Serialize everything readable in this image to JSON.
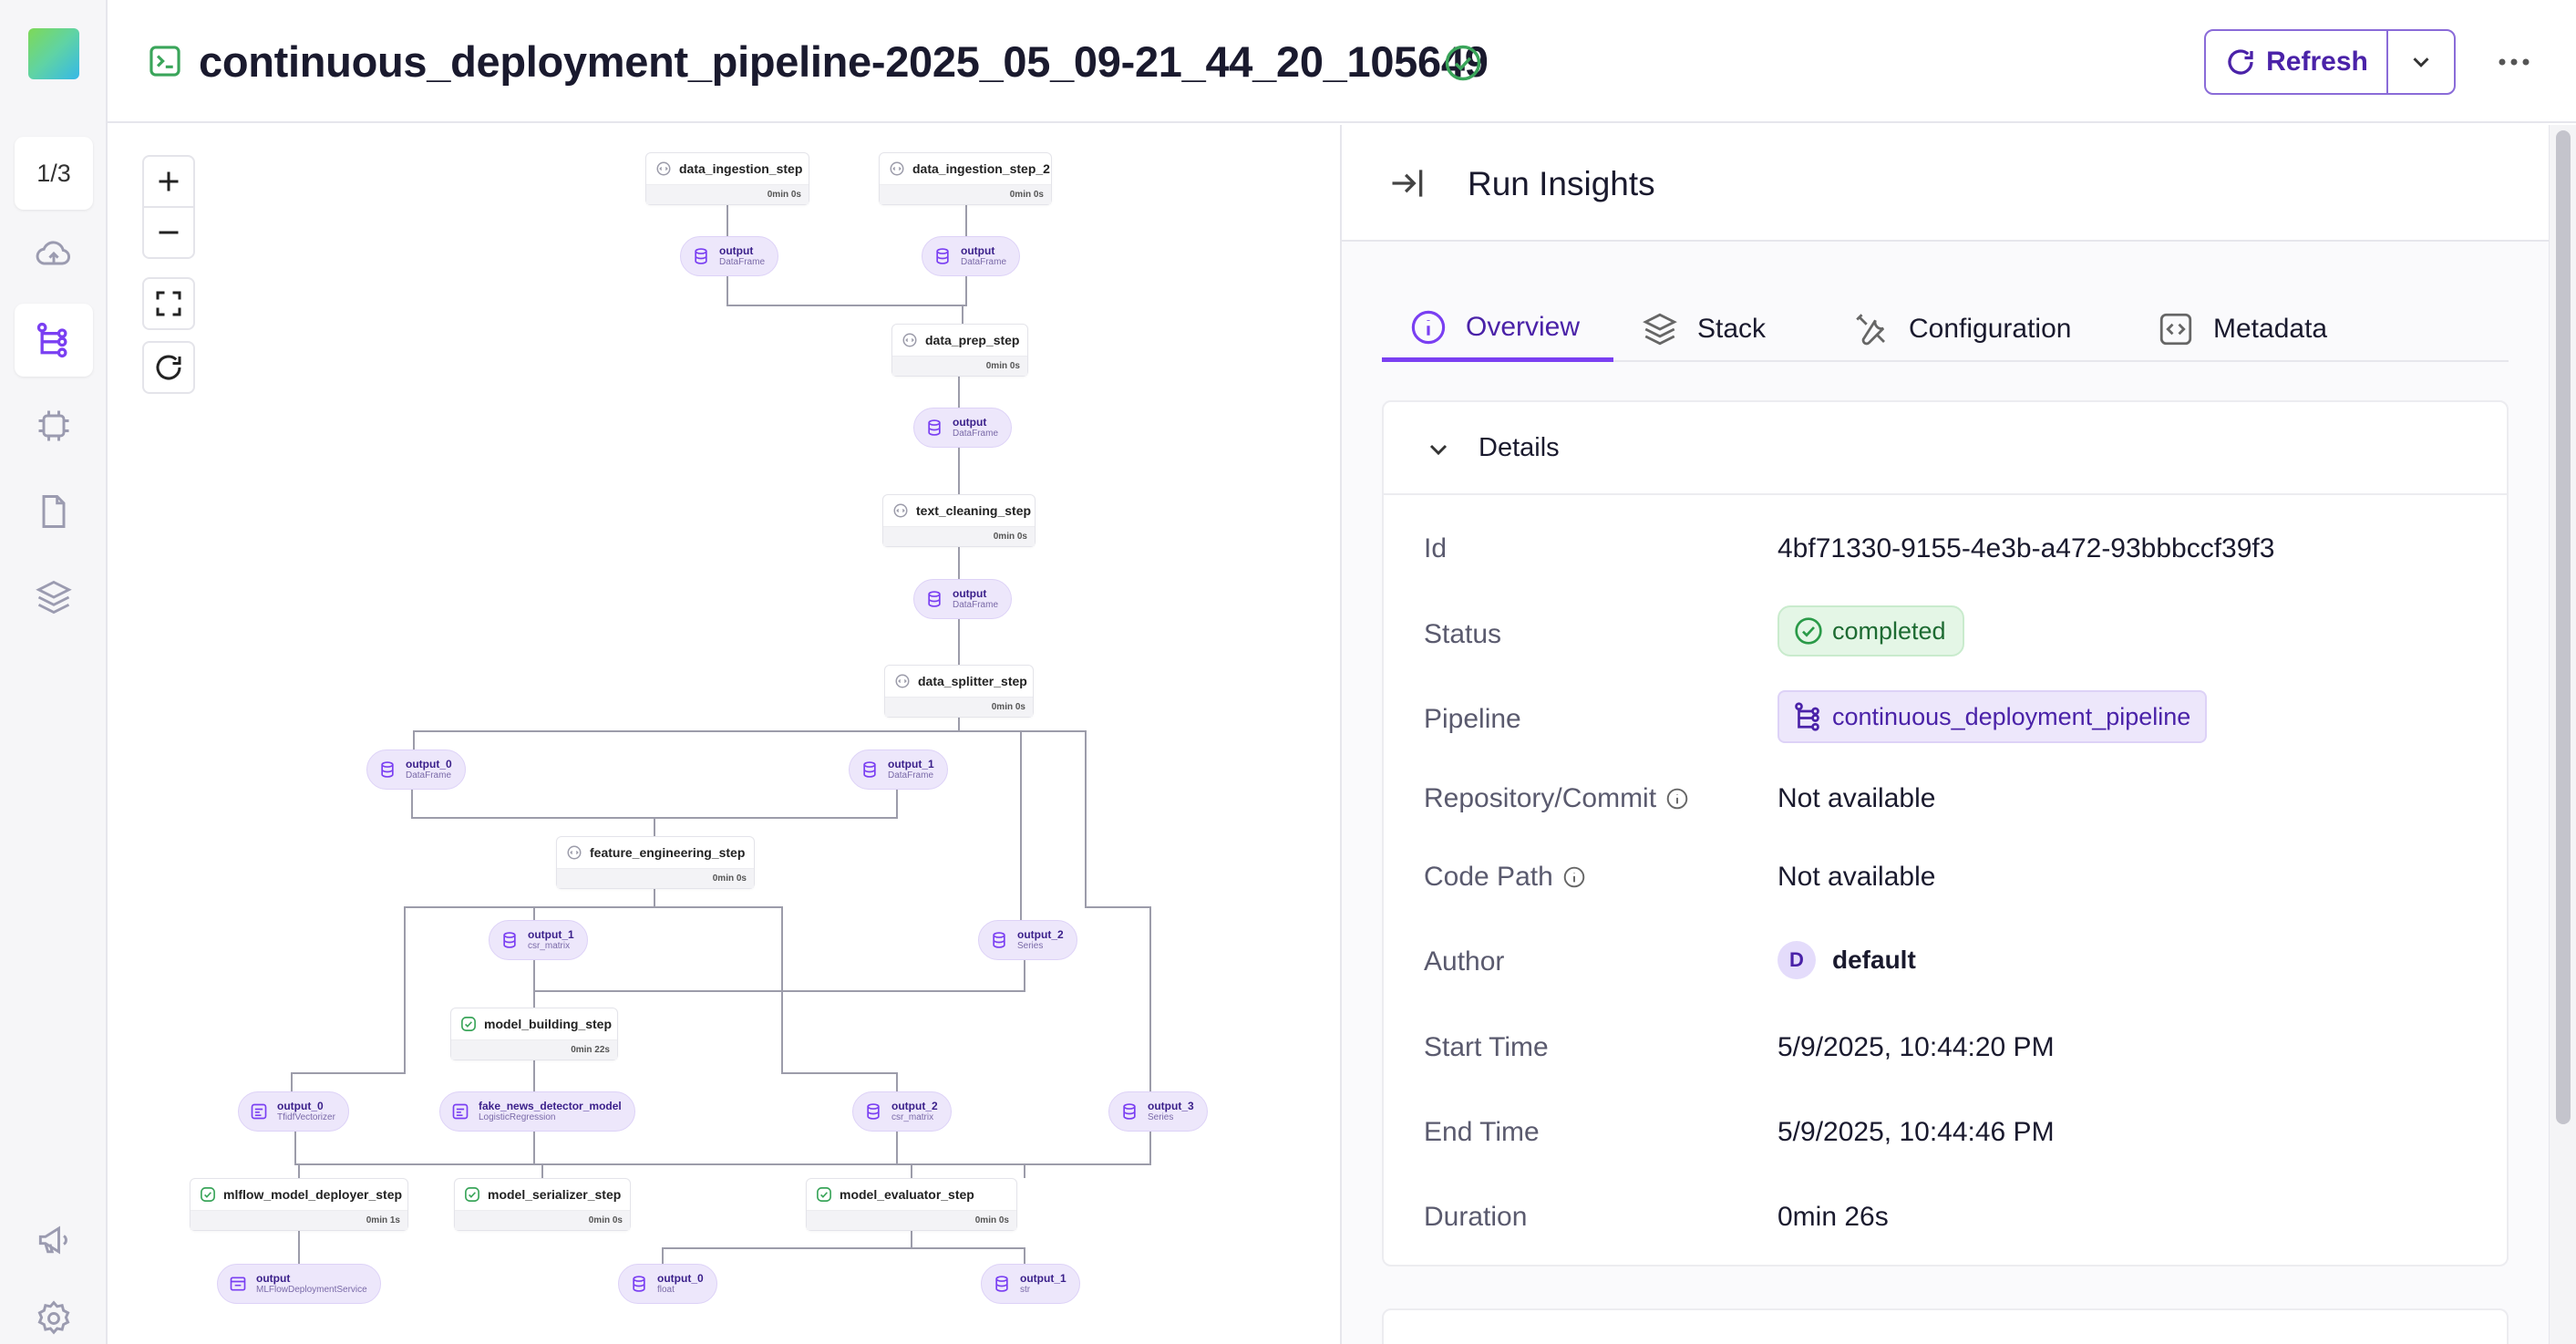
{
  "sidebar": {
    "counter": "1/3",
    "items": [
      {
        "icon": "cloud-icon"
      },
      {
        "icon": "pipeline-icon",
        "active": true
      },
      {
        "icon": "chip-icon"
      },
      {
        "icon": "document-icon"
      },
      {
        "icon": "stack-icon"
      },
      {
        "icon": "megaphone-icon"
      },
      {
        "icon": "gear-icon"
      }
    ]
  },
  "header": {
    "title": "continuous_deployment_pipeline-2025_05_09-21_44_20_105649",
    "refresh_label": "Refresh"
  },
  "dag": {
    "steps": [
      {
        "name": "data_ingestion_step",
        "duration": "0min 0s",
        "status": "cached"
      },
      {
        "name": "data_ingestion_step_2",
        "duration": "0min 0s",
        "status": "cached"
      },
      {
        "name": "data_prep_step",
        "duration": "0min 0s",
        "status": "cached"
      },
      {
        "name": "text_cleaning_step",
        "duration": "0min 0s",
        "status": "cached"
      },
      {
        "name": "data_splitter_step",
        "duration": "0min 0s",
        "status": "cached"
      },
      {
        "name": "feature_engineering_step",
        "duration": "0min 0s",
        "status": "cached"
      },
      {
        "name": "model_building_step",
        "duration": "0min 22s",
        "status": "completed"
      },
      {
        "name": "mlflow_model_deployer_step",
        "duration": "0min 1s",
        "status": "completed"
      },
      {
        "name": "model_serializer_step",
        "duration": "0min 0s",
        "status": "completed"
      },
      {
        "name": "model_evaluator_step",
        "duration": "0min 0s",
        "status": "completed"
      }
    ],
    "artifacts": [
      {
        "name": "output",
        "type": "DataFrame"
      },
      {
        "name": "output",
        "type": "DataFrame"
      },
      {
        "name": "output",
        "type": "DataFrame"
      },
      {
        "name": "output",
        "type": "DataFrame"
      },
      {
        "name": "output_0",
        "type": "DataFrame"
      },
      {
        "name": "output_1",
        "type": "DataFrame"
      },
      {
        "name": "output_1",
        "type": "csr_matrix"
      },
      {
        "name": "output_2",
        "type": "Series"
      },
      {
        "name": "output_0",
        "type": "TfidfVectorizer"
      },
      {
        "name": "fake_news_detector_model",
        "type": "LogisticRegression"
      },
      {
        "name": "output_2",
        "type": "csr_matrix"
      },
      {
        "name": "output_3",
        "type": "Series"
      },
      {
        "name": "output",
        "type": "MLFlowDeploymentService"
      },
      {
        "name": "output_0",
        "type": "float"
      },
      {
        "name": "output_1",
        "type": "str"
      }
    ]
  },
  "insights": {
    "title": "Run Insights",
    "tabs": [
      "Overview",
      "Stack",
      "Configuration",
      "Metadata"
    ],
    "details_title": "Details",
    "rows": {
      "id_label": "Id",
      "id_value": "4bf71330-9155-4e3b-a472-93bbbccf39f3",
      "status_label": "Status",
      "status_value": "completed",
      "pipeline_label": "Pipeline",
      "pipeline_value": "continuous_deployment_pipeline",
      "repo_label": "Repository/Commit",
      "repo_value": "Not available",
      "code_path_label": "Code Path",
      "code_path_value": "Not available",
      "author_label": "Author",
      "author_initial": "D",
      "author_value": "default",
      "start_label": "Start Time",
      "start_value": "5/9/2025, 10:44:20 PM",
      "end_label": "End Time",
      "end_value": "5/9/2025, 10:44:46 PM",
      "duration_label": "Duration",
      "duration_value": "0min 26s"
    }
  },
  "colors": {
    "accent": "#7a3ff2",
    "success": "#3aa55a",
    "artifact_bg": "#ede7fb"
  }
}
